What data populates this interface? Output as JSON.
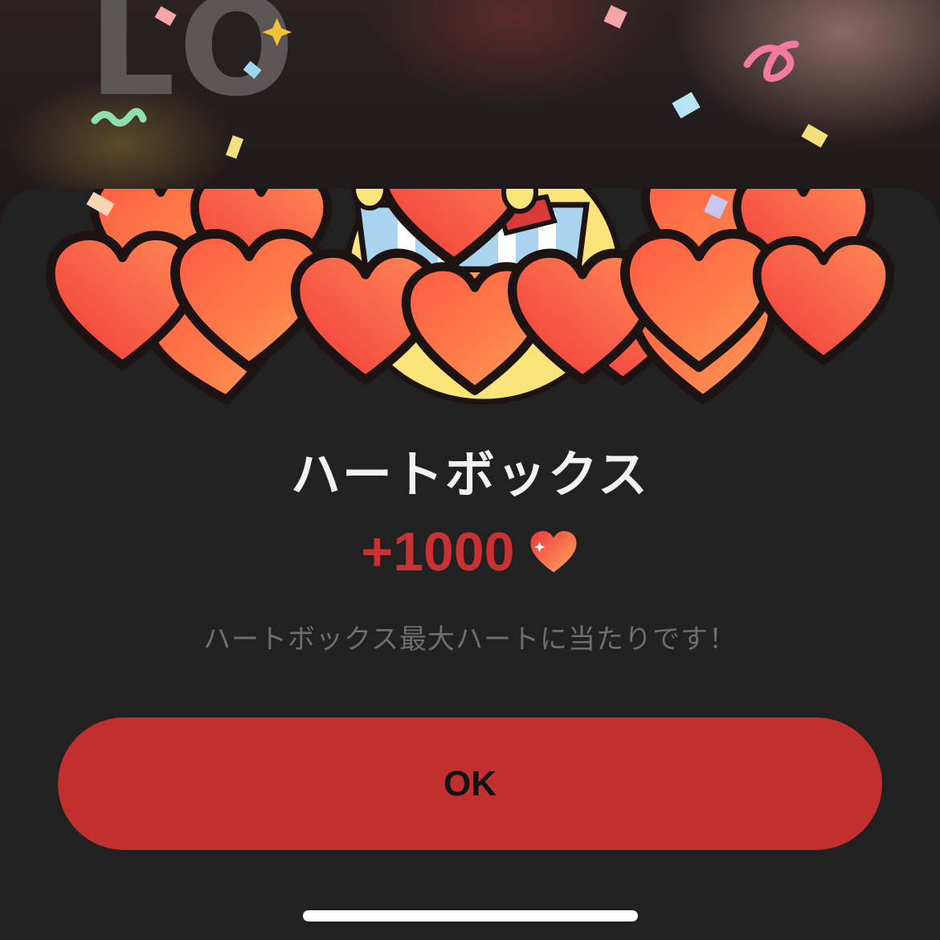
{
  "background": {
    "stream_letters": "LO"
  },
  "dialog": {
    "title": "ハートボックス",
    "reward_amount": "+1000",
    "reward_icon": "heart-icon",
    "message": "ハートボックス最大ハートに当たりです！",
    "ok_label": "OK"
  },
  "colors": {
    "accent": "#c12f2f",
    "reward_text": "#c93232",
    "sheet_background": "#212121"
  }
}
